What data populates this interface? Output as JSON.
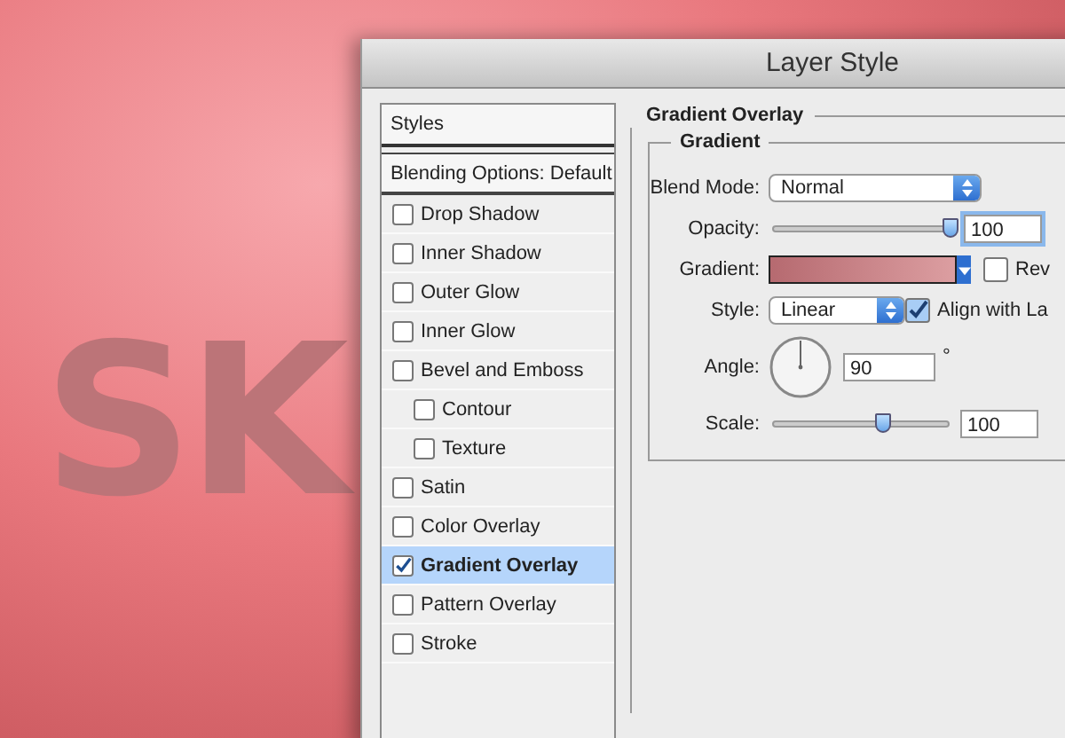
{
  "canvas": {
    "text": "SK"
  },
  "window": {
    "title": "Layer Style"
  },
  "styles_panel": {
    "header": "Styles",
    "blending_options": "Blending Options: Default",
    "items": [
      {
        "label": "Drop Shadow",
        "checked": false,
        "selected": false
      },
      {
        "label": "Inner Shadow",
        "checked": false,
        "selected": false
      },
      {
        "label": "Outer Glow",
        "checked": false,
        "selected": false
      },
      {
        "label": "Inner Glow",
        "checked": false,
        "selected": false
      },
      {
        "label": "Bevel and Emboss",
        "checked": false,
        "selected": false,
        "children": [
          {
            "label": "Contour",
            "checked": false,
            "selected": false
          },
          {
            "label": "Texture",
            "checked": false,
            "selected": false
          }
        ]
      },
      {
        "label": "Satin",
        "checked": false,
        "selected": false
      },
      {
        "label": "Color Overlay",
        "checked": false,
        "selected": false
      },
      {
        "label": "Gradient Overlay",
        "checked": true,
        "selected": true
      },
      {
        "label": "Pattern Overlay",
        "checked": false,
        "selected": false
      },
      {
        "label": "Stroke",
        "checked": false,
        "selected": false
      }
    ]
  },
  "settings": {
    "section_title": "Gradient Overlay",
    "group_title": "Gradient",
    "blend_mode": {
      "label": "Blend Mode:",
      "value": "Normal"
    },
    "opacity": {
      "label": "Opacity:",
      "level": 0.98,
      "value": "100"
    },
    "gradient": {
      "label": "Gradient:"
    },
    "reverse": {
      "label": "Rev",
      "checked": false
    },
    "style": {
      "label": "Style:",
      "value": "Linear"
    },
    "align": {
      "label": "Align with La",
      "checked": true
    },
    "angle": {
      "label": "Angle:",
      "value": "90",
      "unit": "°"
    },
    "scale": {
      "label": "Scale:",
      "level": 0.62,
      "value": "100"
    }
  }
}
